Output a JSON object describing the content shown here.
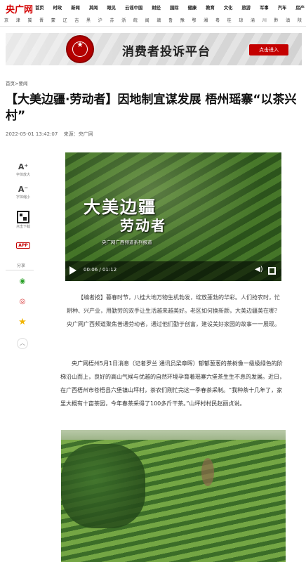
{
  "site": {
    "logo": "央广网"
  },
  "nav": {
    "row1": [
      "首页",
      "时政",
      "新闻",
      "其闻",
      "眼见",
      "云谣中国",
      "财经",
      "国际",
      "健康",
      "教育",
      "文化",
      "旅游",
      "军事",
      "汽车",
      "房产"
    ],
    "row2": [
      "京",
      "津",
      "冀",
      "晋",
      "蒙",
      "辽",
      "吉",
      "黑",
      "沪",
      "苏",
      "浙",
      "皖",
      "闽",
      "赣",
      "鲁",
      "豫",
      "鄂",
      "湘",
      "粤",
      "桂",
      "琼",
      "渝",
      "川",
      "黔",
      "滇",
      "陕"
    ]
  },
  "banner": {
    "title": "消费者投诉平台",
    "button": "点击进入",
    "seal_text": "★"
  },
  "breadcrumb": {
    "home": "首页",
    "sep": " > ",
    "section": "要闻"
  },
  "article": {
    "headline": "【大美边疆·劳动者】因地制宜谋发展 梧州瑶寨“以茶兴村”",
    "date": "2022-05-01 13:42:07",
    "source": "来源：央广网",
    "editor_note": "【编者按】暮春时节，八桂大地万物生机勃发，绽放蓬勃的华彩。人们抢农时，忙耕种、兴产业，用勤劳的双手让生活越来越美好。老区如何换新颜，大美边疆美在哪？央广网广西频道聚焦普通劳动者，通过他们勤于创富，建设美好家园的故事一一展现。",
    "paragraph": "央广网梧州5月1日消息（记者罗兰 通讯员梁章晖）郁郁葱葱的茶树像一级级绿色的阶梯沿山而上，良好的高山气候与优越的自然环境孕育着瑶寨六堡茶生生不息的发展。近日，在广西梧州市苍梧县六堡镇山坪村，茶农们刚忙完这一季春茶采制。“我种茶十几年了，家里大概有十亩茶园，今年春茶采得了100多斤干茶。”山坪村村民赵丽贞说。"
  },
  "tools": {
    "font_up_glyph": "A⁺",
    "font_up": "字体放大",
    "font_down_glyph": "A⁻",
    "font_down": "字体缩小",
    "qr_label": "点击下载",
    "app": "APP",
    "share": "分享",
    "wechat_glyph": "◉",
    "weibo_glyph": "◎",
    "fav_glyph": "★",
    "collapse_glyph": "︿"
  },
  "video": {
    "title1": "大美边疆",
    "title2": "劳动者",
    "subtitle": "央广网广西频道系列报道",
    "time": "00:06 / 01:12",
    "volume_glyph": "◀)"
  }
}
